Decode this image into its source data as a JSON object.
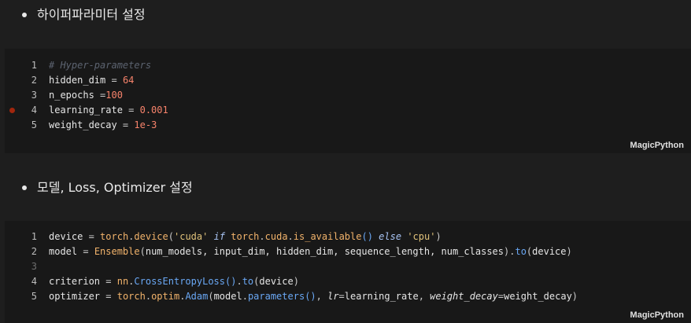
{
  "markdown_cells": [
    {
      "bullet": "하이퍼파라미터 설정"
    },
    {
      "bullet": "모델, Loss, Optimizer 설정"
    }
  ],
  "code_cells": [
    {
      "language_label": "MagicPython",
      "lines": [
        {
          "num": "1",
          "tokens": [
            {
              "t": "# Hyper-parameters",
              "c": "comment"
            }
          ]
        },
        {
          "num": "2",
          "tokens": [
            {
              "t": "hidden_dim",
              "c": "id"
            },
            {
              "t": " = ",
              "c": "op"
            },
            {
              "t": "64",
              "c": "num"
            }
          ]
        },
        {
          "num": "3",
          "tokens": [
            {
              "t": "n_epochs",
              "c": "id"
            },
            {
              "t": " =",
              "c": "op"
            },
            {
              "t": "100",
              "c": "num"
            }
          ]
        },
        {
          "num": "4",
          "tokens": [
            {
              "t": "learning_rate",
              "c": "id"
            },
            {
              "t": " = ",
              "c": "op"
            },
            {
              "t": "0.001",
              "c": "num"
            }
          ]
        },
        {
          "num": "5",
          "tokens": [
            {
              "t": "weight_decay",
              "c": "id"
            },
            {
              "t": " = ",
              "c": "op"
            },
            {
              "t": "1e-3",
              "c": "num"
            }
          ]
        }
      ]
    },
    {
      "language_label": "MagicPython",
      "lines": [
        {
          "num": "1",
          "tokens": [
            {
              "t": "device",
              "c": "id"
            },
            {
              "t": " = ",
              "c": "op"
            },
            {
              "t": "torch",
              "c": "fn"
            },
            {
              "t": ".",
              "c": "punc"
            },
            {
              "t": "device",
              "c": "fn"
            },
            {
              "t": "(",
              "c": "punc"
            },
            {
              "t": "'cuda'",
              "c": "str"
            },
            {
              "t": " ",
              "c": "op"
            },
            {
              "t": "if",
              "c": "kw"
            },
            {
              "t": " ",
              "c": "op"
            },
            {
              "t": "torch",
              "c": "fn"
            },
            {
              "t": ".",
              "c": "punc"
            },
            {
              "t": "cuda",
              "c": "fn"
            },
            {
              "t": ".",
              "c": "punc"
            },
            {
              "t": "is_available",
              "c": "fn"
            },
            {
              "t": "()",
              "c": "paren"
            },
            {
              "t": " ",
              "c": "op"
            },
            {
              "t": "else",
              "c": "kw"
            },
            {
              "t": " ",
              "c": "op"
            },
            {
              "t": "'cpu'",
              "c": "str"
            },
            {
              "t": ")",
              "c": "punc"
            }
          ]
        },
        {
          "num": "2",
          "tokens": [
            {
              "t": "model",
              "c": "id"
            },
            {
              "t": " = ",
              "c": "op"
            },
            {
              "t": "Ensemble",
              "c": "fn"
            },
            {
              "t": "(",
              "c": "punc"
            },
            {
              "t": "num_models, input_dim, hidden_dim, sequence_length, num_classes",
              "c": "id"
            },
            {
              "t": ")",
              "c": "punc"
            },
            {
              "t": ".",
              "c": "punc"
            },
            {
              "t": "to",
              "c": "cls"
            },
            {
              "t": "(",
              "c": "punc"
            },
            {
              "t": "device",
              "c": "id"
            },
            {
              "t": ")",
              "c": "punc"
            }
          ]
        },
        {
          "num": "3",
          "tokens": []
        },
        {
          "num": "4",
          "tokens": [
            {
              "t": "criterion",
              "c": "id"
            },
            {
              "t": " = ",
              "c": "op"
            },
            {
              "t": "nn",
              "c": "fn"
            },
            {
              "t": ".",
              "c": "punc"
            },
            {
              "t": "CrossEntropyLoss",
              "c": "cls"
            },
            {
              "t": "()",
              "c": "paren"
            },
            {
              "t": ".",
              "c": "punc"
            },
            {
              "t": "to",
              "c": "cls"
            },
            {
              "t": "(",
              "c": "punc"
            },
            {
              "t": "device",
              "c": "id"
            },
            {
              "t": ")",
              "c": "punc"
            }
          ]
        },
        {
          "num": "5",
          "tokens": [
            {
              "t": "optimizer",
              "c": "id"
            },
            {
              "t": " = ",
              "c": "op"
            },
            {
              "t": "torch",
              "c": "fn"
            },
            {
              "t": ".",
              "c": "punc"
            },
            {
              "t": "optim",
              "c": "fn"
            },
            {
              "t": ".",
              "c": "punc"
            },
            {
              "t": "Adam",
              "c": "cls"
            },
            {
              "t": "(",
              "c": "punc"
            },
            {
              "t": "model",
              "c": "id"
            },
            {
              "t": ".",
              "c": "punc"
            },
            {
              "t": "parameters",
              "c": "cls"
            },
            {
              "t": "()",
              "c": "paren"
            },
            {
              "t": ", ",
              "c": "punc"
            },
            {
              "t": "lr",
              "c": "kwarg"
            },
            {
              "t": "=",
              "c": "op"
            },
            {
              "t": "learning_rate",
              "c": "id"
            },
            {
              "t": ", ",
              "c": "punc"
            },
            {
              "t": "weight_decay",
              "c": "kwarg"
            },
            {
              "t": "=",
              "c": "op"
            },
            {
              "t": "weight_decay",
              "c": "id"
            },
            {
              "t": ")",
              "c": "punc"
            }
          ]
        }
      ]
    }
  ],
  "breakpoint": {
    "cell": 0,
    "line": "4"
  },
  "colors": {
    "background": "#1e1e1e",
    "cell_background": "#181818",
    "breakpoint": "#a1260d"
  }
}
